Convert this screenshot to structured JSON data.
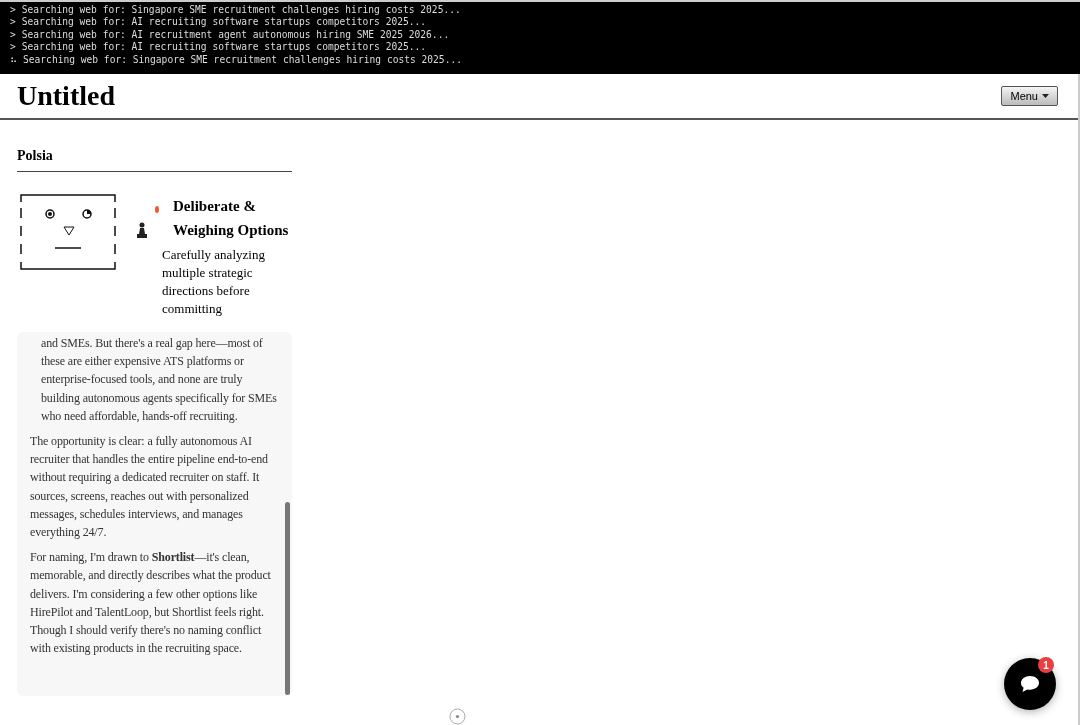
{
  "terminal": {
    "lines": [
      {
        "prefix": ">",
        "text": "Searching web for: Singapore SME recruitment challenges hiring costs 2025..."
      },
      {
        "prefix": ">",
        "text": "Searching web for: AI recruiting software startups competitors 2025..."
      },
      {
        "prefix": ">",
        "text": "Searching web for: AI recruitment agent autonomous hiring SME 2025 2026..."
      },
      {
        "prefix": ">",
        "text": "Searching web for: AI recruiting software startups competitors 2025..."
      },
      {
        "prefix": "⠦",
        "text": "Searching web for: Singapore SME recruitment challenges hiring costs 2025..."
      }
    ]
  },
  "header": {
    "title": "Untitled",
    "menu_button": "Menu"
  },
  "sidebar": {
    "title": "Polsia",
    "status": {
      "color": "#f05a28",
      "heading": "Deliberate & Weighing Options",
      "description": "Carefully analyzing multiple strategic directions before committing"
    },
    "thoughts": [
      {
        "kind": "continuation",
        "text": "and SMEs. But there's a real gap here—most of these are either expensive ATS platforms or enterprise-focused tools, and none are truly building autonomous agents specifically for SMEs who need affordable, hands-off recruiting."
      },
      {
        "kind": "paragraph",
        "text": "The opportunity is clear: a fully autonomous AI recruiter that handles the entire pipeline end-to-end without requiring a dedicated recruiter on staff. It sources, screens, reaches out with personalized messages, schedules interviews, and manages everything 24/7."
      },
      {
        "kind": "paragraph",
        "text": "For naming, I'm drawn to **Shortlist**—it's clean, memorable, and directly describes what the product delivers. I'm considering a few other options like HirePilot and TalentLoop, but Shortlist feels right. Though I should verify there's no naming conflict with existing products in the recruiting space."
      }
    ]
  },
  "chat": {
    "badge": "1"
  }
}
